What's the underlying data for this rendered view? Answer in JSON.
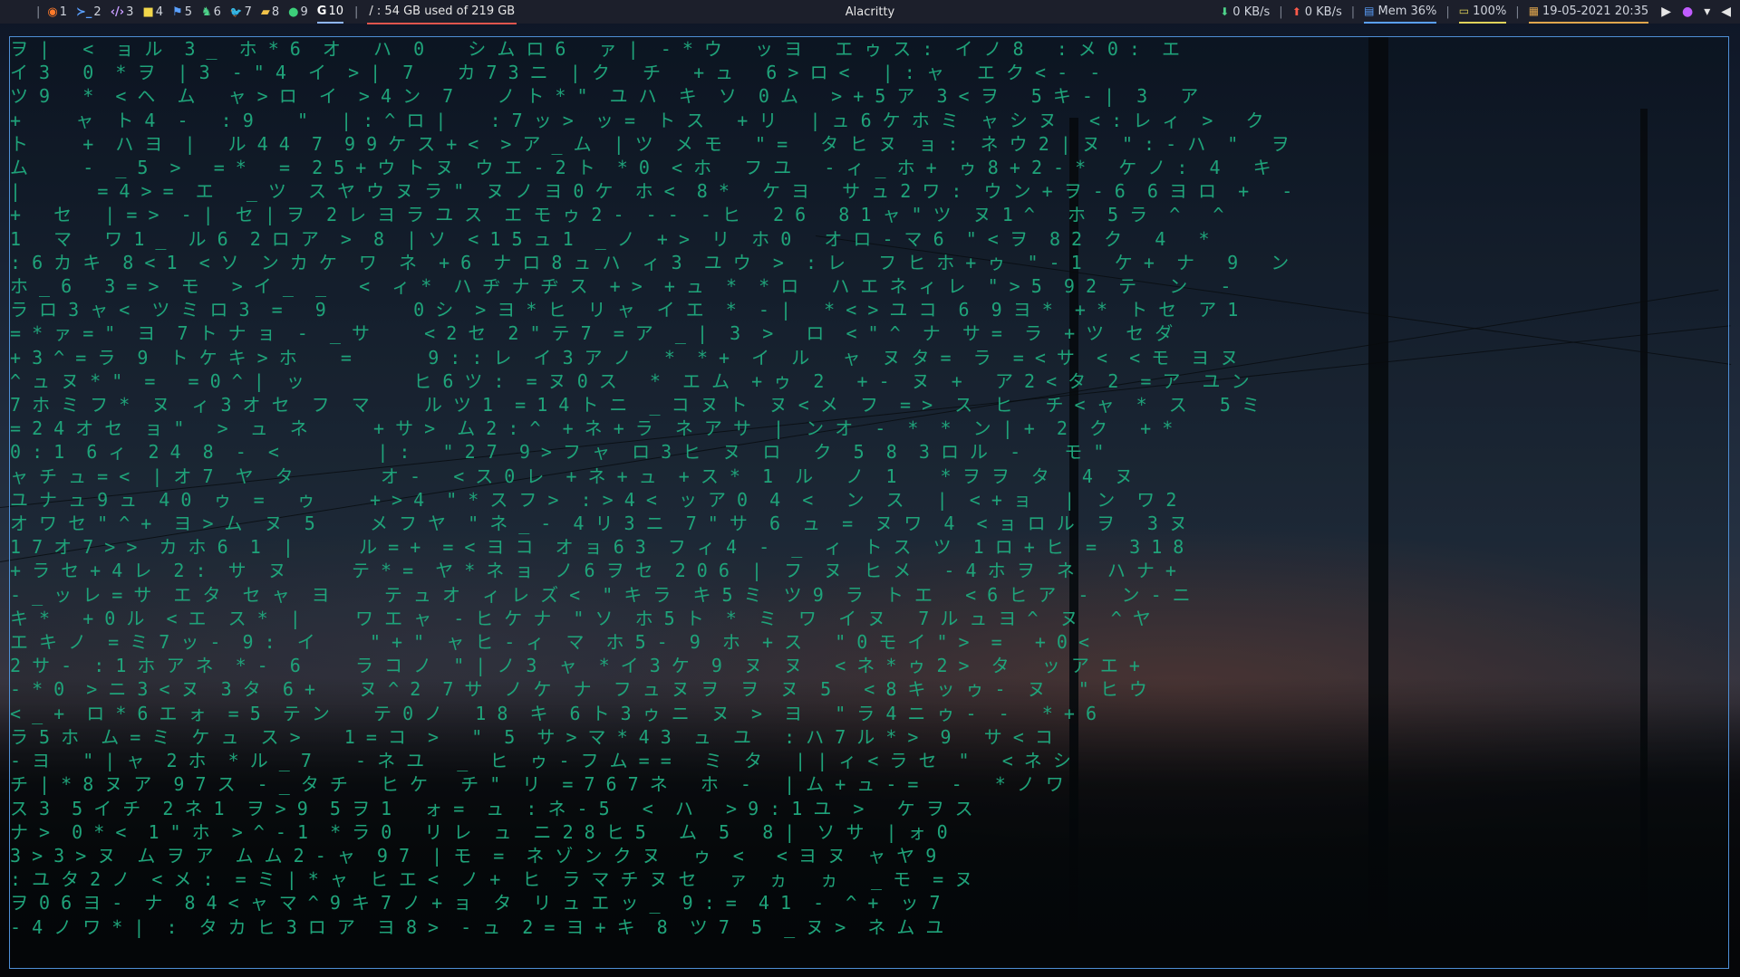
{
  "window": {
    "title": "Alacritty"
  },
  "workspaces": [
    {
      "num": "1",
      "glyph": "◉",
      "color": "#ff7a2a"
    },
    {
      "num": "2",
      "glyph": "≻_",
      "color": "#5aa0ff"
    },
    {
      "num": "3",
      "glyph": "‹/›",
      "color": "#c79cff"
    },
    {
      "num": "4",
      "glyph": "■",
      "color": "#f1d64a"
    },
    {
      "num": "5",
      "glyph": "⚑",
      "color": "#5aa0ff"
    },
    {
      "num": "6",
      "glyph": "♞",
      "color": "#4ed38a"
    },
    {
      "num": "7",
      "glyph": "🐦",
      "color": "#4aa8ff"
    },
    {
      "num": "8",
      "glyph": "▰",
      "color": "#f1c24a"
    },
    {
      "num": "9",
      "glyph": "●",
      "color": "#3ccf7a"
    },
    {
      "num": "10",
      "glyph": "G",
      "color": "#ffffff"
    }
  ],
  "active_workspace": "10",
  "disk": "/ : 54 GB used of 219 GB",
  "net": {
    "down": "0 KB/s",
    "up": "0 KB/s"
  },
  "mem": "Mem 36%",
  "battery": "100%",
  "datetime": "19-05-2021 20:35",
  "colors": {
    "bar_bg": "#1c1f2b",
    "matrix_green": "#1fa37a",
    "border": "#4f8fd6"
  },
  "matrix_lines": [
    "ヲ |   <  ョ ル  3 _  ホ * 6  オ   ハ  0    シ ム ロ 6   ァ |  - * ウ   ッ ヨ   エ ゥ ス :  イ ノ 8   : メ 0 :  エ",
    "イ 3   0  * ヲ  | 3  - \" 4  イ  > |  7    カ 7 3 ニ  | ク   チ   + ュ   6 > ロ <   | : ャ   エ ク < -  -",
    "ツ 9   *  < ヘ  ム   ャ > ロ  イ  > 4 ン  7    ノ ト * \"  ユ ハ  キ  ソ  0 ム   > + 5 ア  3 < ヲ   5 キ - |  3   ア",
    "+     ャ  ト 4  -   : 9    \"   | : ^ ロ |    : 7 ッ >  ッ =  ト ス   + リ   | ュ 6 ケ ホ ミ  ャ シ ヌ   < : レ ィ  >   ク",
    "ト     +  ハ ヨ  |   ル 4 4  7  9 9 ケ ス + <  > ア _ ム  | ツ  メ モ   \" =   タ ヒ ヌ  ョ :  ネ ウ 2 | ヌ  \" : - ハ  \"   ヲ",
    "ム     -  _ 5  >   = *   =  2 5 + ウ ト ヌ  ウ エ - 2 ト  * 0  < ホ   フ ユ   - ィ _ ホ +  ゥ 8 + 2 - *   ケ ノ :  4   キ",
    "|       = 4 > =  エ   _ ツ  ス ヤ ウ ヌ ラ \"  ヌ ノ ヨ 0 ケ  ホ <  8 *   ケ ヨ   サ ュ 2 ワ :  ウ ン + ヲ - 6  6 ヨ ロ  +   -",
    "+   セ   | = >  - |  セ | ヲ  2 レ ヨ ラ ユ ス  エ モ ゥ 2 -  - -  - ヒ   2 6   8 1 ャ \" ツ  ヌ 1 ^   ホ  5 ラ  ^   ^",
    "1   マ   ワ 1 _  ル 6  2 ロ ア  >  8  | ソ  < 1 5 ュ 1  _ ノ  + >  リ  ホ 0   オ ロ - マ 6  \" < ヲ  8 2  ク   4   *",
    ": 6 カ キ  8 < 1  < ソ  ン カ ケ  ワ  ネ  + 6  ナ ロ 8 ュ ハ  ィ 3  ユ ウ  >  : レ   フ ヒ ホ + ゥ  \" - 1   ケ +  ナ   9   ン",
    "ホ _ 6   3 = >  モ   > イ _  _   <  ィ *  ハ ヂ ナ ヂ ス  + >  + ュ  *  * ロ   ハ エ ネ ィ レ  \" > 5  9 2  テ   ン   -",
    "ラ ロ 3 ャ <  ツ ミ ロ 3  =   9        0 シ  > ヨ * ヒ  リ ャ  イ エ  *  - |   * < > ユ コ  6  9 ヨ *  + *  ト セ  ア 1",
    "= * ァ = \"  ヨ  7 ト ナ ョ  -  _ サ     < 2 セ  2 \" テ 7  = ア  _ |  3  >   ロ  < \" ^  ナ  サ =  ラ  + ツ  セ ダ",
    "+ 3 ^ = ラ  9  ト ケ キ > ホ    =       9 : : レ  イ 3 ア ノ   *  * +  イ  ル   ャ  ヌ タ =  ラ  = < サ  <  < モ  ヨ ヌ",
    "^ ュ ヌ * \"  =   = 0 ^ |  ッ          ヒ 6 ツ :  = ヌ 0 ス   *  エ ム  + ゥ  2   + -  ヌ  +   ア 2 < タ  2  = ア  ユ ン",
    "7 ホ ミ フ *  ヌ  ィ 3 オ セ  フ  マ     ル ツ 1  = 1 4 ト ニ  _ コ ヌ ト  ヌ < メ  フ  = >  ス  ヒ   チ < ャ  *  ス   5 ミ",
    "= 2 4 オ セ  ョ \"   >  ュ  ネ      + サ >  ム 2 : ^  + ネ + ラ  ネ ア サ  |  ン オ  -  *  *  ン | +  2  ク   + *",
    "0 : 1  6 ィ  2 4  8  -  <         | :   \" 2 7  9 > フ ャ  ロ 3 ヒ  ヌ  ロ   ク  5  8  3 ロ ル  -    モ \"",
    "ャ チ ュ = <  | オ 7  ヤ  タ        オ -   < ス 0 レ  + ネ + ュ  + ス *  1  ル   ノ  1    * ヲ ヲ  タ   4  ヌ",
    "ユ ナ ュ 9 ュ  4 0  ゥ  =   ゥ     + > 4  \" * ス フ >  : > 4 <  ッ ア 0  4  <   ン  ス   |  < + ョ   |  ン  ワ 2",
    "オ ワ セ \" ^ +  ヨ > ム  ヌ  5     メ フ ヤ  \" ネ _ -  4 リ 3 ニ  7 \" サ  6  ュ  =  ヌ ワ  4  < ョ ロ ル  ヲ   3 ヌ",
    "1 7 オ 7 > >  カ ホ 6  1  |      ル = +  = < ヨ コ  オ ョ 6 3  フ ィ 4  -  _  ィ  ト ス  ツ  1 ロ + ヒ  =   3 1 8",
    "+ ラ セ + 4 レ  2 :  サ  ヌ      テ * =  ヤ * ネ ョ  ノ 6 ヲ セ  2 0 6  |  フ  ヌ  ヒ メ   - 4 ホ ヲ  ネ   ハ ナ +",
    "- _ ッ レ = サ  エ タ  セ ャ  ヨ     テ ュ オ  ィ レ ズ <  \" キ ラ  キ 5 ミ  ツ 9  ラ  ト エ   < 6 ヒ ア  -   ン - ニ",
    "キ *   + 0 ル  < エ  ス *  |     ワ エ ャ  - ヒ ケ ナ  \" ソ  ホ 5 ト  *  ミ  ワ  イ ヌ   7 ル ュ ヨ ^  ヌ   ^ ヤ",
    "エ キ ノ  = ミ 7 ッ -  9 :  イ     \" + \"  ャ ヒ - ィ  マ  ホ 5 -  9  ホ  + ス   \" 0 モ イ \" >  =   + 0 <",
    "2 サ -  : 1 ホ ア ネ  * -  6     ラ コ ノ  \" | ノ 3  ャ  * イ 3 ケ  9  ヌ  ヌ   < ネ * ゥ 2 >  タ   ッ ア エ +",
    "- * 0  > ニ 3 < ヌ  3 タ  6 +    ヌ ^ 2  7 サ  ノ ケ  ナ  フ ュ ヌ ヲ  ヲ  ヌ  5   < 8 キ ッ ゥ -  ヌ   \" ヒ ウ",
    "< _ +  ロ * 6 エ ォ  = 5  テ ン    テ 0 ノ   1 8  キ  6 ト 3 ゥ ニ  ヌ  >  ヨ   \" ラ 4 ニ ゥ -  -   * + 6",
    "ラ 5 ホ  ム = ミ  ケ ュ  ス >    1 = コ  >   \"  5  サ > マ * 4 3  ュ  ユ   : ハ 7 ル * >  9   サ < コ",
    "- ヨ   \" | ャ  2 ホ  * ル _ 7    - ネ ユ   _  ヒ  ゥ - フ ム = =   ミ  タ   | | ィ < ラ セ  \"   < ネ シ",
    "チ | * 8 ヌ ア  9 7 ス  - _ タ チ   ヒ ケ   チ \"  リ  = 7 6 7 ネ   ホ  -   | ム + ュ - =   -   * ノ ワ",
    "ス 3  5 イ チ  2 ネ 1  ヲ > 9  5 ヲ 1   ォ =  ュ  : ネ - 5   <  ハ   > 9 : 1 ユ  >   ケ ヲ ス",
    "ナ >  0 * <  1 \" ホ  > ^ - 1  * ラ 0   リ レ  ュ  ニ 2 8 ヒ 5   ム  5   8 |  ソ サ  | ォ 0",
    "3 > 3 > ヌ  ム ヲ ア  ム ム 2 - ャ  9 7  | モ  =  ネ ゾ ン ク ヌ   ゥ  <   < ヨ ヌ  ャ ヤ 9",
    ": ユ タ 2 ノ  < メ :  = ミ | * ャ  ヒ エ <  ノ +  ヒ  ラ マ チ ヌ セ   ァ  ヵ   ヵ   _ モ  = ヌ",
    "ヲ 0 6 ヨ -  ナ  8 4 < ャ マ ^ 9 キ 7 ノ + ョ  タ  リ ュ エ ッ _  9 : =  4 1  -  ^ +  ッ 7",
    "- 4 ノ ワ * |  :  タ カ ヒ 3 ロ ア  ヨ 8 >  - ュ  2 = ヨ + キ  8  ツ 7  5  _ ヌ >  ネ ム ユ"
  ]
}
